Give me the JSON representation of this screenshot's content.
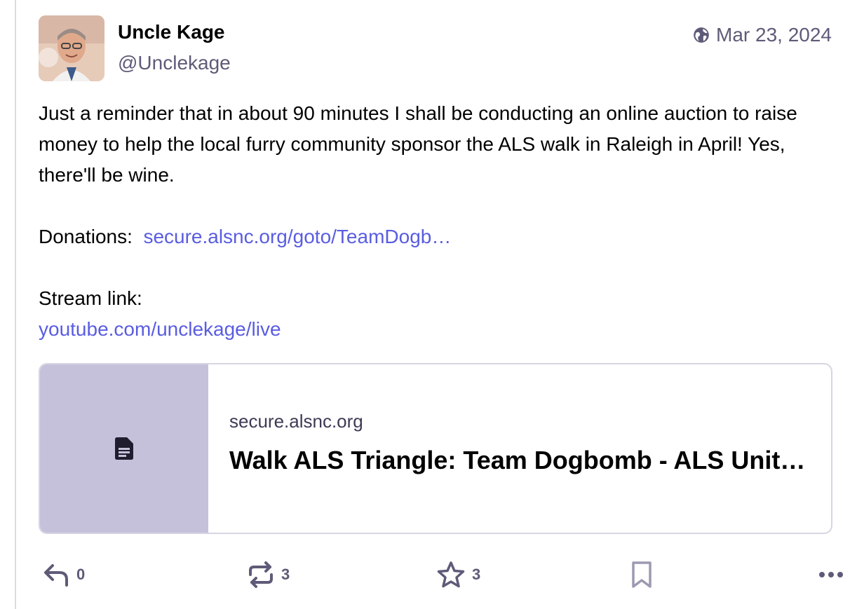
{
  "post": {
    "author": {
      "display_name": "Uncle Kage",
      "handle": "@Unclekage",
      "avatar_icon": "avatar-photo"
    },
    "visibility_icon": "globe-icon",
    "date": "Mar 23, 2024",
    "paragraphs": [
      "Just a reminder that in about 90 minutes I shall be conducting an online auction to raise money to help the local furry community sponsor the ALS walk in Raleigh in April!  Yes, there'll be wine."
    ],
    "donations_label": "Donations:",
    "donations_link": "secure.alsnc.org/goto/TeamDogb…",
    "stream_label": "Stream link:",
    "stream_link": "youtube.com/unclekage/live"
  },
  "card": {
    "domain": "secure.alsnc.org",
    "title": "Walk ALS Triangle: Team Dogbomb - ALS Unit…",
    "thumb_icon": "document-icon"
  },
  "actions": {
    "reply_count": "0",
    "boost_count": "3",
    "favourite_count": "3"
  },
  "colors": {
    "link": "#5a5de0",
    "muted": "#5e5b78",
    "thumb_bg": "#c6c1db"
  }
}
